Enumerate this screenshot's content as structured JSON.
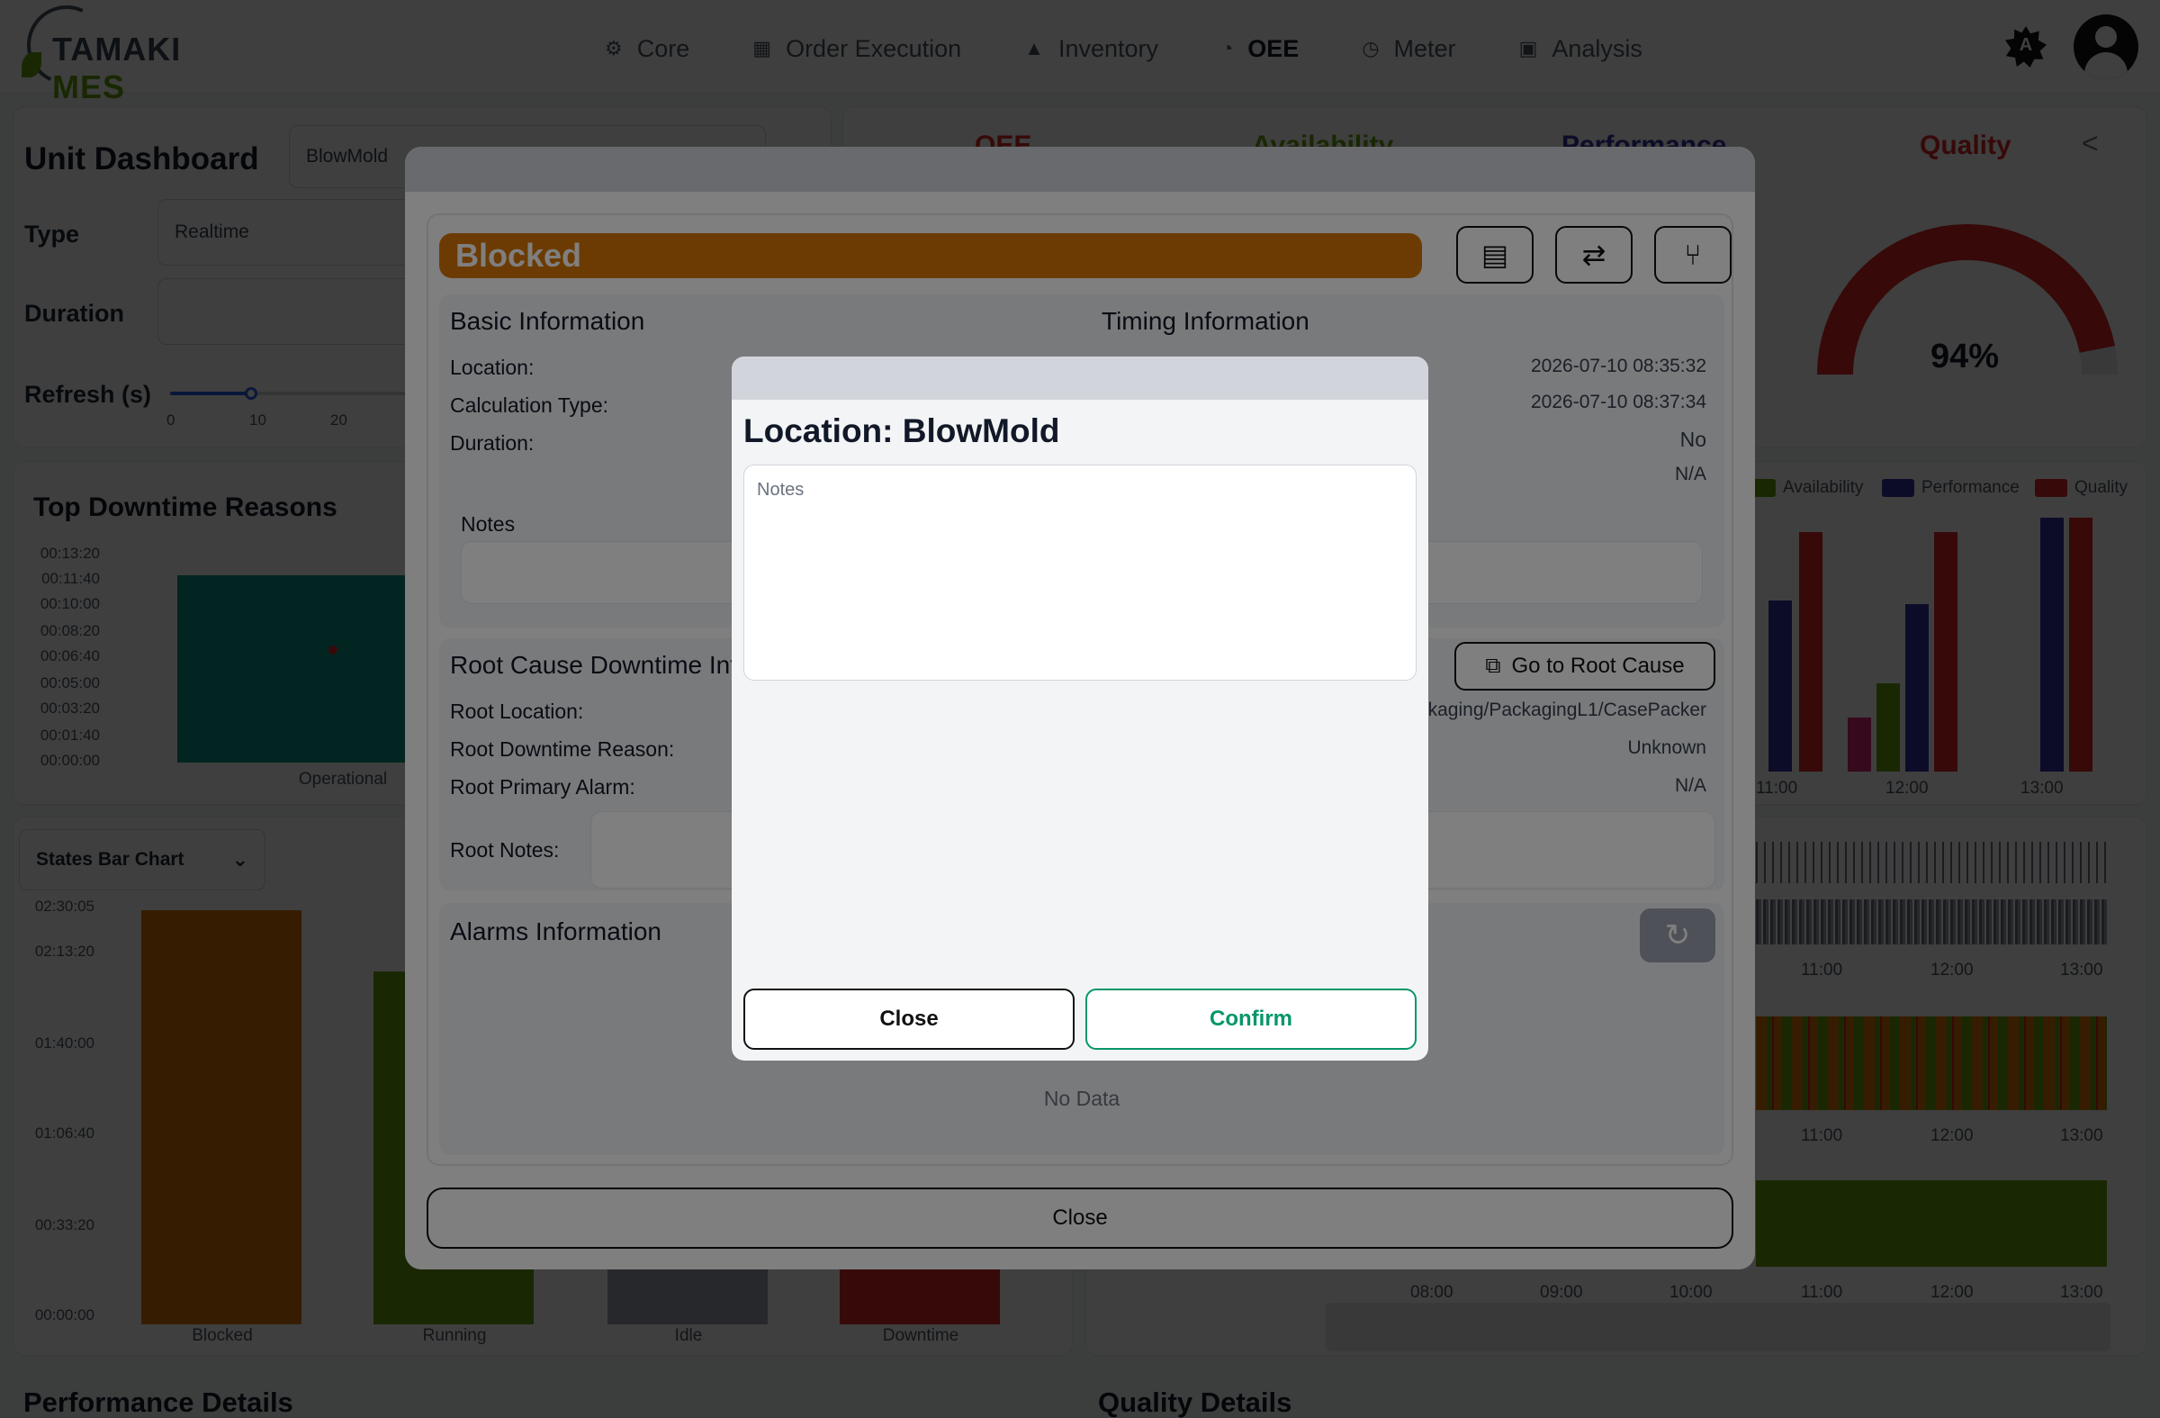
{
  "app": {
    "logo_part1": "TAMAKI",
    "logo_part2": "MES"
  },
  "nav": [
    {
      "label": "Core",
      "icon": "gear-icon"
    },
    {
      "label": "Order Execution",
      "icon": "calendar-icon"
    },
    {
      "label": "Inventory",
      "icon": "boxes-icon"
    },
    {
      "label": "OEE",
      "icon": "gauge-icon",
      "active": true
    },
    {
      "label": "Meter",
      "icon": "meter-icon"
    },
    {
      "label": "Analysis",
      "icon": "chart-icon"
    }
  ],
  "theme_letter": "A",
  "unit_dashboard": {
    "title": "Unit Dashboard",
    "unit_value": "BlowMold",
    "type_label": "Type",
    "type_value": "Realtime",
    "duration_label": "Duration",
    "refresh_label": "Refresh (s)",
    "refresh_ticks": [
      "0",
      "10",
      "20"
    ],
    "refresh_value": 10
  },
  "kpi_tabs": {
    "oee": "OEE",
    "availability": "Availability",
    "performance": "Performance",
    "quality": "Quality"
  },
  "quality_gauge": {
    "value_label": "94%",
    "value": 94
  },
  "legend": [
    {
      "label": "Availability",
      "color": "#65a30d"
    },
    {
      "label": "Performance",
      "color": "#3730a3"
    },
    {
      "label": "Quality",
      "color": "#dc2626"
    }
  ],
  "kpi_bar_ticks": [
    "11:00",
    "12:00",
    "13:00"
  ],
  "timeline_ticks": [
    "11:00",
    "12:00",
    "13:00"
  ],
  "bottom_axis_ticks": [
    "08:00",
    "09:00",
    "10:00",
    "11:00",
    "12:00",
    "13:00"
  ],
  "top_downtime": {
    "title": "Top Downtime Reasons",
    "y_ticks": [
      "00:13:20",
      "00:11:40",
      "00:10:00",
      "00:08:20",
      "00:06:40",
      "00:05:00",
      "00:03:20",
      "00:01:40",
      "00:00:00"
    ],
    "categories": [
      "Operational"
    ]
  },
  "states_chart": {
    "select_label": "States Bar Chart",
    "y_ticks": [
      "02:30:05",
      "02:13:20",
      "01:40:00",
      "01:06:40",
      "00:33:20",
      "00:00:00"
    ],
    "categories": [
      "Blocked",
      "Running",
      "Idle",
      "Downtime"
    ]
  },
  "section_titles": {
    "performance": "Performance Details",
    "quality": "Quality Details"
  },
  "event_modal": {
    "status": "Blocked",
    "basic_title": "Basic Information",
    "timing_title": "Timing Information",
    "basic_labels": [
      "Location:",
      "Calculation Type:",
      "Duration:"
    ],
    "timing_values": [
      "2026-07-10 08:35:32",
      "2026-07-10 08:37:34",
      "No",
      "N/A"
    ],
    "notes_label": "Notes",
    "root_title": "Root Cause Downtime Inf",
    "root_button": "Go to Root Cause",
    "root_labels": [
      "Root Location:",
      "Root Downtime Reason:",
      "Root Primary Alarm:"
    ],
    "root_values": [
      "ackaging/PackagingL1/CasePacker",
      "Unknown",
      "N/A"
    ],
    "root_notes_label": "Root Notes:",
    "alarms_title": "Alarms Information",
    "no_data": "No Data",
    "close": "Close"
  },
  "notes_modal": {
    "title": "Location: BlowMold",
    "placeholder": "Notes",
    "close": "Close",
    "confirm": "Confirm"
  }
}
